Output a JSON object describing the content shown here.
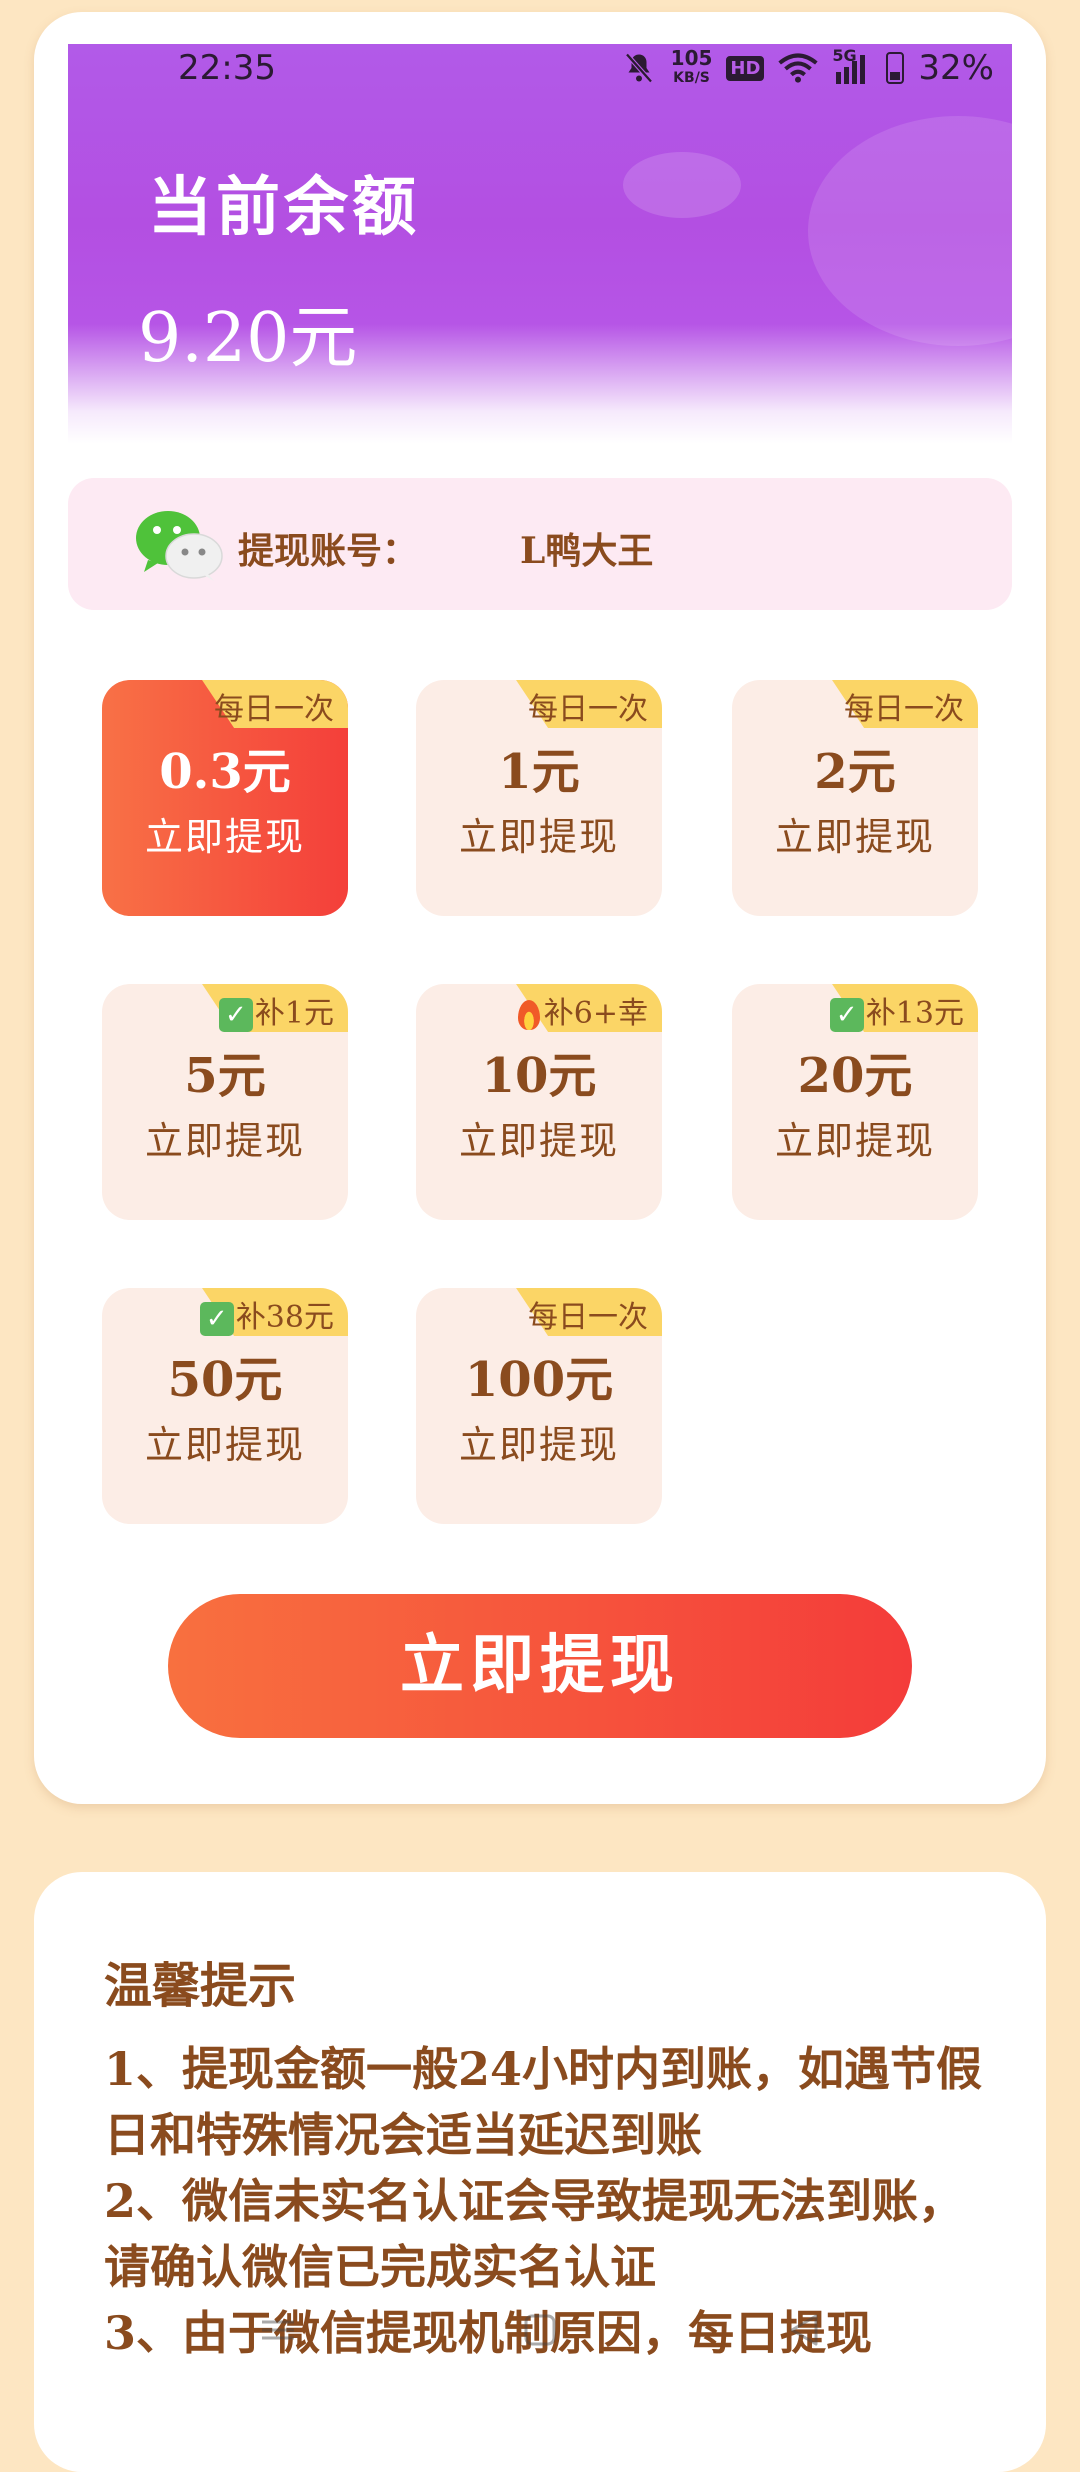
{
  "status_bar": {
    "time": "22:35",
    "net_speed_value": "105",
    "net_speed_unit": "KB/S",
    "hd_label": "HD",
    "network_label": "5G",
    "battery": "32%"
  },
  "header": {
    "title": "当前余额",
    "balance": "9.20元"
  },
  "account": {
    "label": "提现账号：",
    "name": "L鸭大王"
  },
  "options": [
    {
      "badge": "每日一次",
      "amount": "0.3元",
      "action": "立即提现",
      "selected": true
    },
    {
      "badge": "每日一次",
      "amount": "1元",
      "action": "立即提现"
    },
    {
      "badge": "每日一次",
      "amount": "2元",
      "action": "立即提现"
    },
    {
      "badge": "补1元",
      "badge_icon": "check",
      "amount": "5元",
      "action": "立即提现"
    },
    {
      "badge": "补6+幸",
      "badge_icon": "flame",
      "amount": "10元",
      "action": "立即提现"
    },
    {
      "badge": "补13元",
      "badge_icon": "check",
      "amount": "20元",
      "action": "立即提现"
    },
    {
      "badge": "补38元",
      "badge_icon": "check",
      "amount": "50元",
      "action": "立即提现"
    },
    {
      "badge": "每日一次",
      "amount": "100元",
      "action": "立即提现"
    }
  ],
  "withdraw_button": "立即提现",
  "tips": {
    "title": "温馨提示",
    "lines": [
      "1、提现金额一般24小时内到账，如遇节假日和特殊情况会适当延迟到账",
      "2、微信未实名认证会导致提现无法到账，请确认微信已完成实名认证",
      "3、由于微信提现机制原因，每日提现"
    ]
  },
  "colors": {
    "page_bg": "#fde6c2",
    "header_purple": "#b25ae8",
    "accent_red": "#f43f3a",
    "text_brown": "#8a4b1e",
    "badge_yellow": "#fbd566"
  }
}
